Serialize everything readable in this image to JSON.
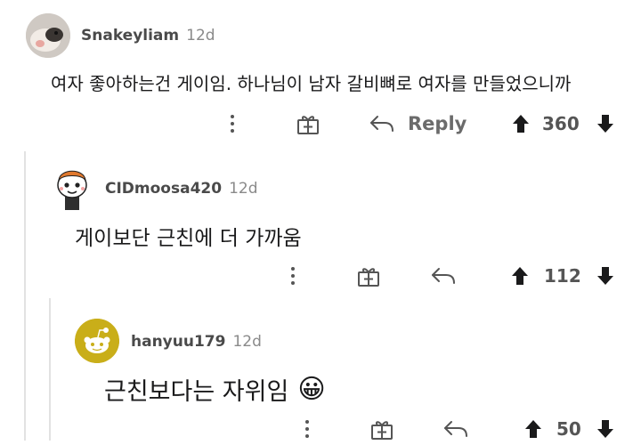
{
  "comments": [
    {
      "username": "Snakeyliam",
      "age": "12d",
      "body": "여자 좋아하는건 게이임. 하나님이 남자 갈비뼈로 여자를 만들었으니까",
      "reply_label": "Reply",
      "score": "360"
    },
    {
      "username": "CIDmoosa420",
      "age": "12d",
      "body": "게이보단 근친에 더 가까움",
      "score": "112"
    },
    {
      "username": "hanyuu179",
      "age": "12d",
      "body": "근친보다는 자위임",
      "emoji": "😀",
      "score": "50"
    }
  ],
  "icons": {
    "more": "kebab-menu-icon",
    "award": "gift-icon",
    "reply": "reply-arrow-icon",
    "upvote": "upvote-arrow-icon",
    "downvote": "downvote-arrow-icon"
  },
  "colors": {
    "username": "#4a4a4a",
    "meta": "#8a8a8a",
    "icon": "#555555",
    "thread_line": "#e2e2e2",
    "avatar_yellow": "#c9ae19"
  }
}
